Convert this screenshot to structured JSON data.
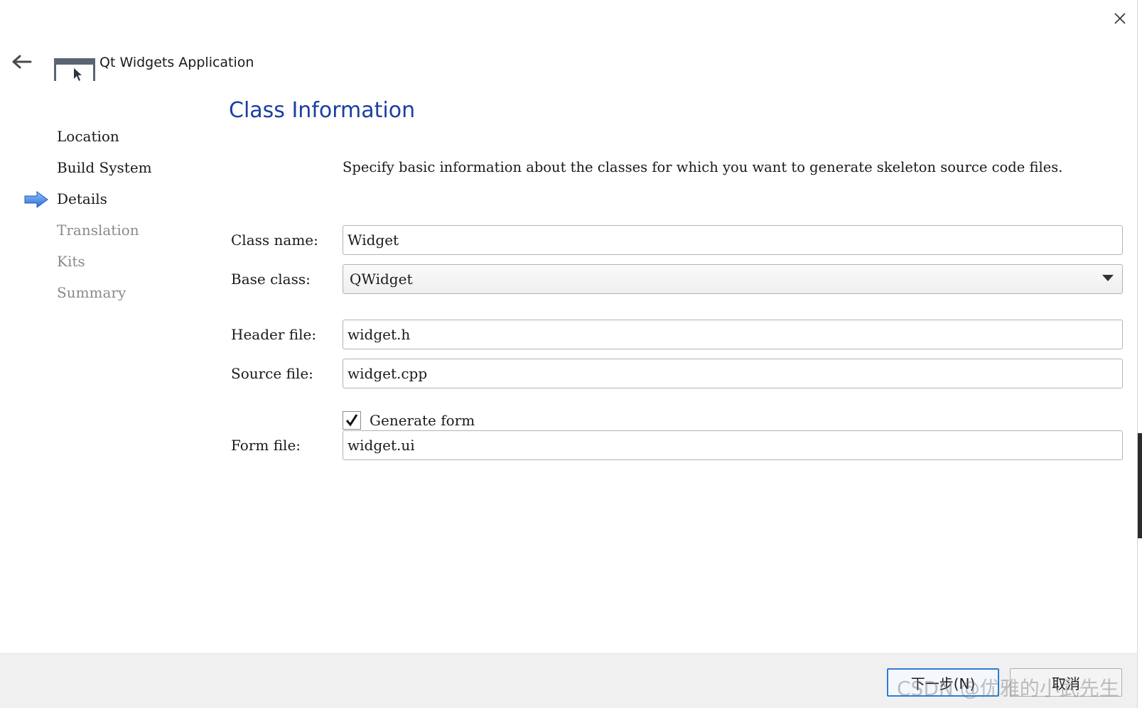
{
  "window": {
    "title": "Qt Widgets Application",
    "close_icon": "close-icon",
    "back_icon": "back-arrow-icon"
  },
  "steps": [
    {
      "label": "Location",
      "state": "done"
    },
    {
      "label": "Build System",
      "state": "done"
    },
    {
      "label": "Details",
      "state": "current"
    },
    {
      "label": "Translation",
      "state": "pending"
    },
    {
      "label": "Kits",
      "state": "pending"
    },
    {
      "label": "Summary",
      "state": "pending"
    }
  ],
  "page": {
    "title": "Class Information",
    "description": "Specify basic information about the classes for which you want to generate skeleton source code files."
  },
  "form": {
    "class_name": {
      "label": "Class name:",
      "value": "Widget"
    },
    "base_class": {
      "label": "Base class:",
      "value": "QWidget"
    },
    "header_file": {
      "label": "Header file:",
      "value": "widget.h"
    },
    "source_file": {
      "label": "Source file:",
      "value": "widget.cpp"
    },
    "generate_form": {
      "label": "Generate form",
      "checked": true
    },
    "form_file": {
      "label": "Form file:",
      "value": "widget.ui"
    }
  },
  "footer": {
    "next_label": "下一步(N)",
    "cancel_label": "取消"
  },
  "watermark": "CSDN @优雅的小武先生",
  "colors": {
    "accent": "#1b3fa0",
    "primary_button_border": "#2e7bd6",
    "current_step_arrow": "#3b7fe0"
  }
}
